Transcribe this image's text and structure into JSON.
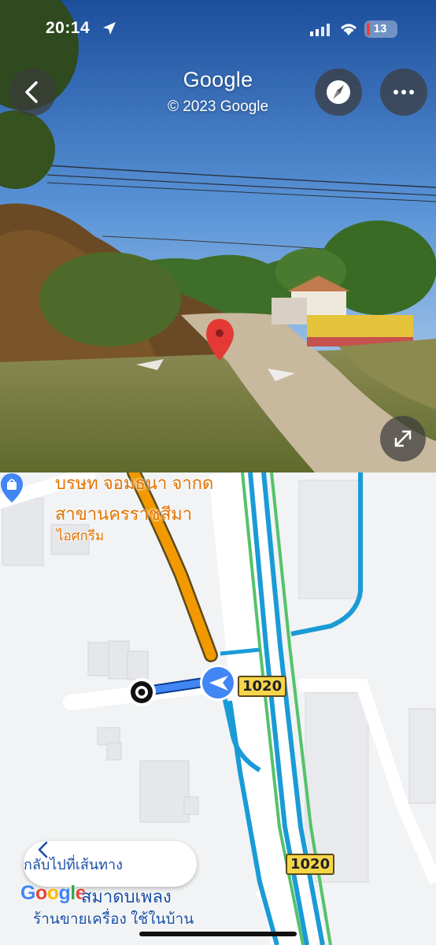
{
  "status_bar": {
    "time": "20:14",
    "battery_level": "13"
  },
  "street_view": {
    "title": "Google",
    "copyright": "© 2023 Google",
    "buttons": {
      "back_icon": "chevron-left-icon",
      "compass_icon": "compass-icon",
      "more_icon": "ellipsis-icon",
      "expand_icon": "expand-icon"
    },
    "marker_color": "#e53935"
  },
  "map": {
    "pois": {
      "company_line1": "บรษท จอมธนา จากด",
      "company_line2": "สาขานครราชสีมา",
      "icecream": "ไอศกรีม",
      "shop_name": "สมาดบเพลง",
      "shop_category": "ร้านขายเครื่อง ใช้ในบ้าน"
    },
    "route_shields": [
      "1020",
      "1020"
    ],
    "back_to_route_label": "กลับไปที่เส้นทาง",
    "google_logo": "Google",
    "colors": {
      "road_orange": "#f29900",
      "route_blue": "#4285f4",
      "road_teal": "#1a9bd7",
      "road_green": "#54c26a"
    }
  }
}
